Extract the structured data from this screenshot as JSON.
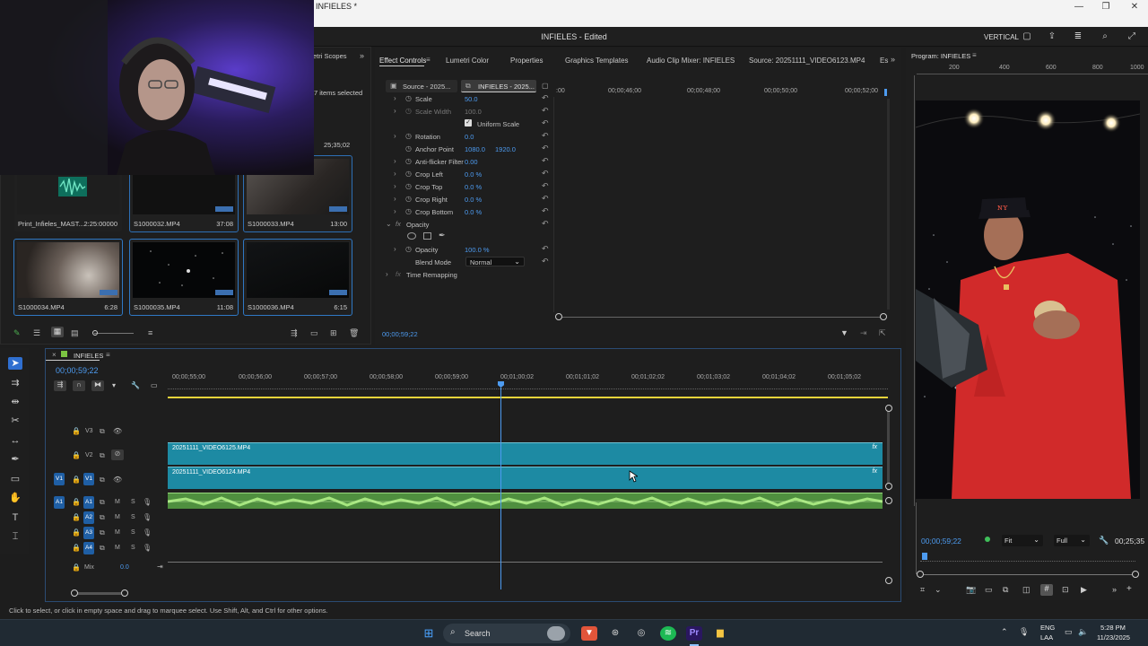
{
  "window": {
    "title": "INFIELES *",
    "minimize": "—",
    "restore": "❐",
    "close": "✕"
  },
  "header": {
    "project_title": "INFIELES - Edited",
    "vertical_label": "VERTICAL"
  },
  "project_panel": {
    "tab_label": "etri Scopes",
    "items_selected": "7 items selected",
    "timecode": "25;35;02",
    "clips": [
      {
        "name": "Print_Infieles_MAST...",
        "duration": "2:25:00000"
      },
      {
        "name": "S1000032.MP4",
        "duration": "37:08"
      },
      {
        "name": "S1000033.MP4",
        "duration": "13:00"
      },
      {
        "name": "S1000034.MP4",
        "duration": "6:28"
      },
      {
        "name": "S1000035.MP4",
        "duration": "11:08"
      },
      {
        "name": "S1000036.MP4",
        "duration": "6:15"
      }
    ]
  },
  "effect_tabs": [
    "Effect Controls",
    "Lumetri Color",
    "Properties",
    "Graphics Templates",
    "Audio Clip Mixer: INFIELES",
    "Source: 20251111_VIDEO6123.MP4",
    "Es"
  ],
  "effect_controls": {
    "source_label": "Source - 2025...",
    "sequence_label": "INFIELES - 2025...",
    "timecode": "00;00;59;22",
    "properties": [
      {
        "name": "Scale",
        "value": "50.0"
      },
      {
        "name": "Scale Width",
        "value": "100.0"
      },
      {
        "name": "Uniform Scale",
        "value": ""
      },
      {
        "name": "Rotation",
        "value": "0.0"
      },
      {
        "name": "Anchor Point",
        "value": "1080.0",
        "value2": "1920.0"
      },
      {
        "name": "Anti-flicker Filter",
        "value": "0.00"
      },
      {
        "name": "Crop Left",
        "value": "0.0 %"
      },
      {
        "name": "Crop Top",
        "value": "0.0 %"
      },
      {
        "name": "Crop Right",
        "value": "0.0 %"
      },
      {
        "name": "Crop Bottom",
        "value": "0.0 %"
      }
    ],
    "opacity_section": "Opacity",
    "opacity": {
      "name": "Opacity",
      "value": "100.0 %"
    },
    "blend_mode": {
      "name": "Blend Mode",
      "value": "Normal"
    },
    "time_remapping": "Time Remapping",
    "ruler": [
      ":00",
      "00;00;46;00",
      "00;00;48;00",
      "00;00;50;00",
      "00;00;52;00"
    ]
  },
  "program_monitor": {
    "title": "Program: INFIELES",
    "ruler": [
      "200",
      "400",
      "600",
      "800",
      "1000"
    ],
    "timecode": "00;00;59;22",
    "fit": "Fit",
    "quality": "Full",
    "duration": "00;25;35"
  },
  "timeline": {
    "sequence_name": "INFIELES",
    "timecode": "00;00;59;22",
    "ruler": [
      "00;00;55;00",
      "00;00;56;00",
      "00;00;57;00",
      "00;00;58;00",
      "00;00;59;00",
      "00;01;00;02",
      "00;01;01;02",
      "00;01;02;02",
      "00;01;03;02",
      "00;01;04;02",
      "00;01;05;02"
    ],
    "tracks": {
      "v3": "V3",
      "v2": "V2",
      "v1": "V1",
      "a1": "A1",
      "a2": "A2",
      "a3": "A3",
      "a4": "A4",
      "mix": "Mix",
      "mix_value": "0.0"
    },
    "clip_v2": "20251111_VIDEO6125.MP4",
    "clip_v1": "20251111_VIDEO6124.MP4",
    "fx": "fx",
    "m": "M",
    "s": "S"
  },
  "status": "Click to select, or click in empty space and drag to marquee select. Use Shift, Alt, and Ctrl for other options.",
  "taskbar": {
    "search": "Search",
    "lang1": "ENG",
    "lang2": "LAA",
    "time": "5:28 PM",
    "date": "11/23/2025"
  },
  "colors": {
    "accent": "#2f78c4",
    "clip_video": "#1d8aa3",
    "clip_audio": "#6cbf5a",
    "playhead": "#4d9bf0"
  }
}
